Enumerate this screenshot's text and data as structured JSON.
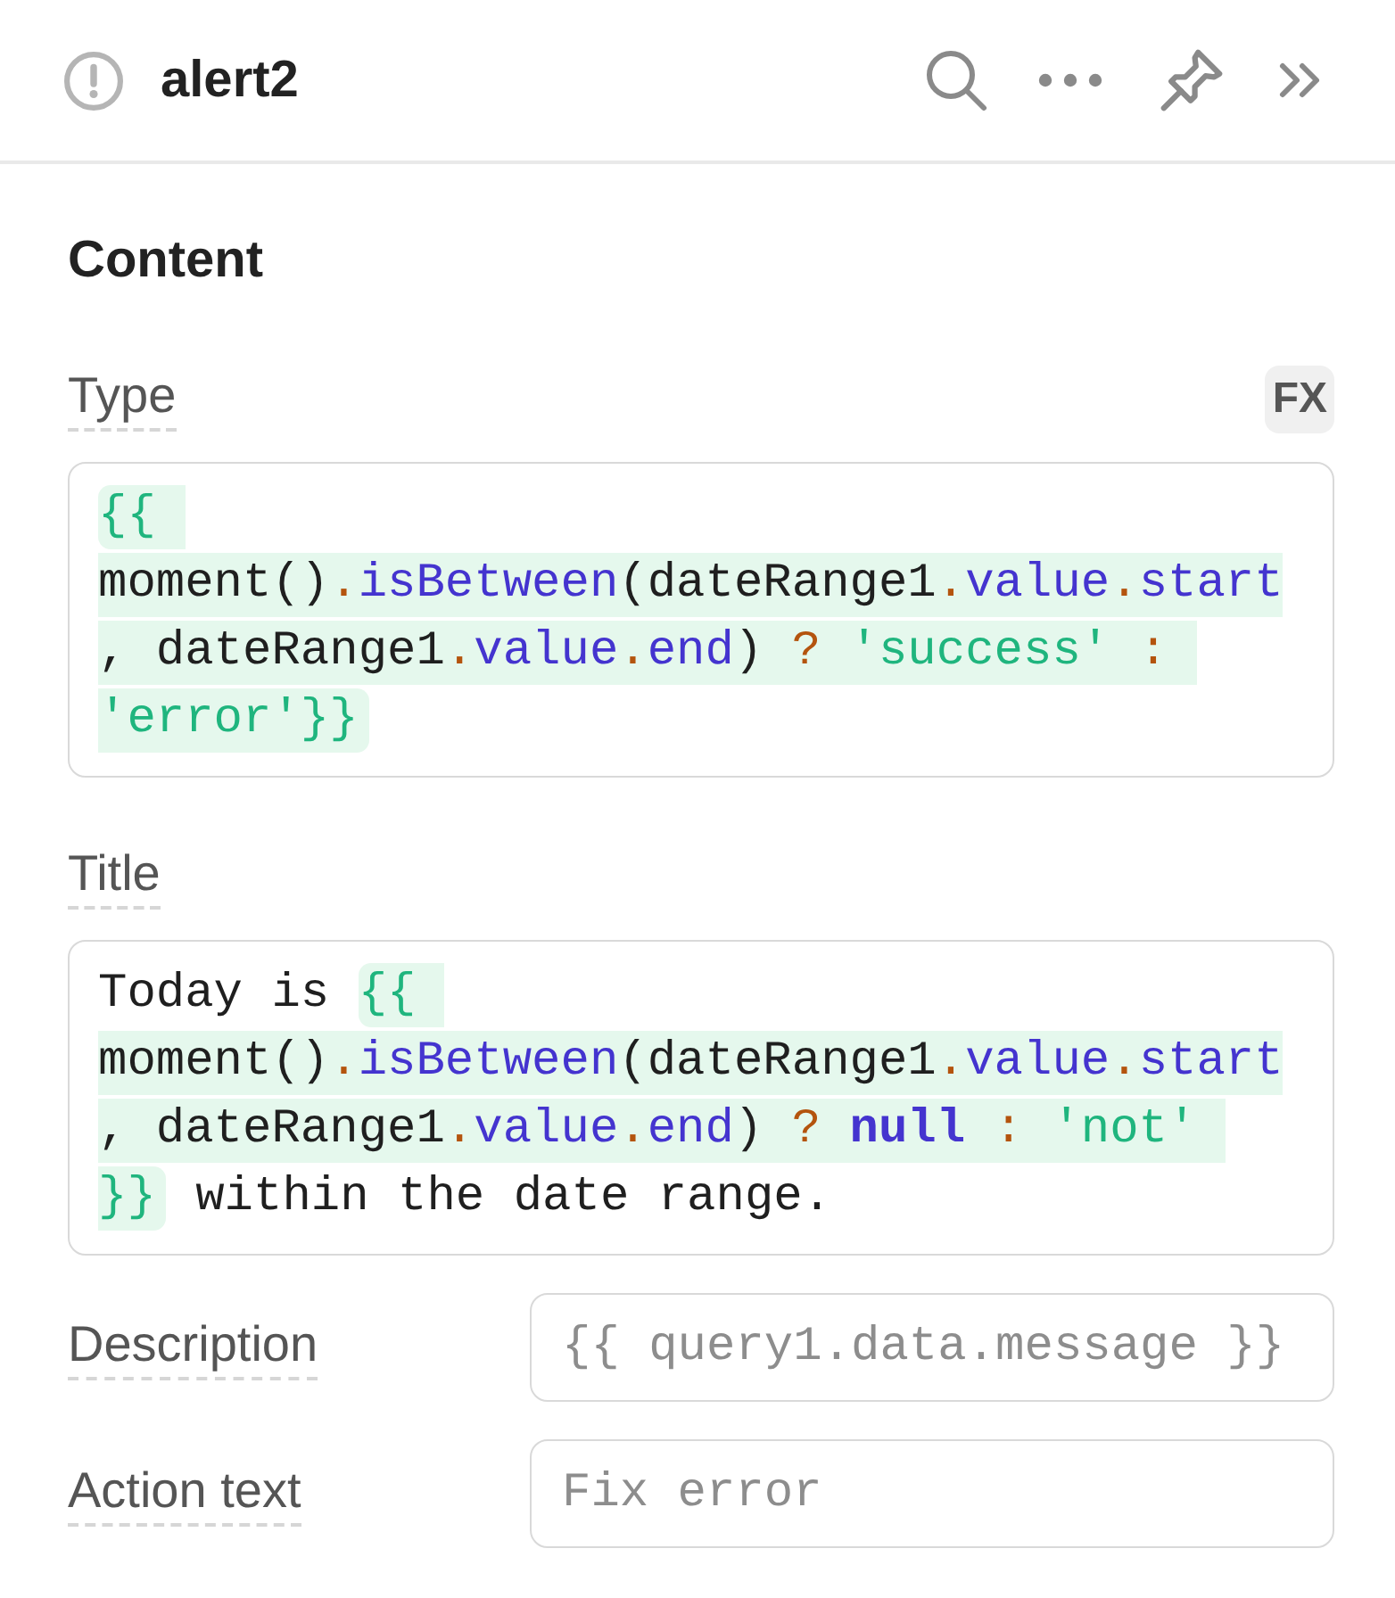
{
  "header": {
    "title": "alert2"
  },
  "section": {
    "title": "Content"
  },
  "fields": [
    {
      "kind": "code",
      "label": "Type",
      "fx_button": "FX",
      "value": [
        {
          "kind": "template",
          "tokens": [
            {
              "kind": "brace",
              "text": "{{ "
            },
            {
              "kind": "plain",
              "text": "moment()"
            },
            {
              "kind": "punct",
              "text": "."
            },
            {
              "kind": "member",
              "text": "isBetween"
            },
            {
              "kind": "plain",
              "text": "(dateRange1"
            },
            {
              "kind": "punct",
              "text": "."
            },
            {
              "kind": "member",
              "text": "value"
            },
            {
              "kind": "punct",
              "text": "."
            },
            {
              "kind": "member",
              "text": "start"
            },
            {
              "kind": "plain",
              "text": ", dateRange1"
            },
            {
              "kind": "punct",
              "text": "."
            },
            {
              "kind": "member",
              "text": "value"
            },
            {
              "kind": "punct",
              "text": "."
            },
            {
              "kind": "member",
              "text": "end"
            },
            {
              "kind": "plain",
              "text": ") "
            },
            {
              "kind": "punct",
              "text": "? "
            },
            {
              "kind": "string",
              "text": "'success' "
            },
            {
              "kind": "punct",
              "text": ": "
            },
            {
              "kind": "string",
              "text": "'error'"
            },
            {
              "kind": "brace",
              "text": "}}"
            }
          ]
        }
      ]
    },
    {
      "kind": "code",
      "label": "Title",
      "value": [
        {
          "kind": "text",
          "text": "Today is "
        },
        {
          "kind": "template",
          "tokens": [
            {
              "kind": "brace",
              "text": "{{ "
            },
            {
              "kind": "plain",
              "text": "moment()"
            },
            {
              "kind": "punct",
              "text": "."
            },
            {
              "kind": "member",
              "text": "isBetween"
            },
            {
              "kind": "plain",
              "text": "(dateRange1"
            },
            {
              "kind": "punct",
              "text": "."
            },
            {
              "kind": "member",
              "text": "value"
            },
            {
              "kind": "punct",
              "text": "."
            },
            {
              "kind": "member",
              "text": "start"
            },
            {
              "kind": "plain",
              "text": ", dateRange1"
            },
            {
              "kind": "punct",
              "text": "."
            },
            {
              "kind": "member",
              "text": "value"
            },
            {
              "kind": "punct",
              "text": "."
            },
            {
              "kind": "member",
              "text": "end"
            },
            {
              "kind": "plain",
              "text": ") "
            },
            {
              "kind": "punct",
              "text": "? "
            },
            {
              "kind": "keyword",
              "text": "null"
            },
            {
              "kind": "punct",
              "text": " : "
            },
            {
              "kind": "string",
              "text": "'not' "
            },
            {
              "kind": "brace",
              "text": "}}"
            }
          ]
        },
        {
          "kind": "text",
          "text": " within the date range."
        }
      ]
    },
    {
      "kind": "input",
      "label": "Description",
      "placeholder": "{{ query1.data.message }}"
    },
    {
      "kind": "input",
      "label": "Action text",
      "placeholder": "Fix error"
    }
  ]
}
